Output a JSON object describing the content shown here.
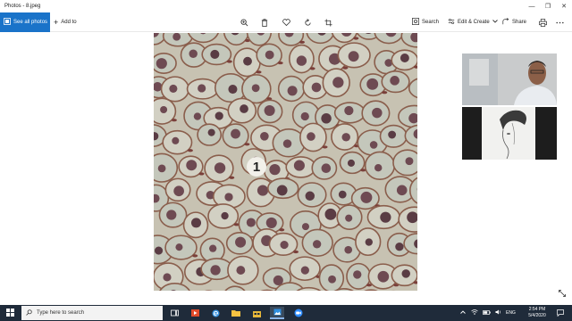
{
  "window": {
    "title": "Photos - 8.jpeg",
    "minimize_glyph": "—",
    "maximize_glyph": "❐",
    "close_glyph": "✕"
  },
  "toolbar": {
    "see_all_label": "See all photos",
    "add_to_label": "Add to",
    "add_glyph": "+",
    "search_label": "Search",
    "edit_create_label": "Edit & Create",
    "share_label": "Share",
    "icons": [
      "zoom-icon",
      "delete-icon",
      "favorite-icon",
      "rotate-icon",
      "crop-icon",
      "print-icon",
      "more-icon"
    ]
  },
  "image": {
    "region_label": "1"
  },
  "taskbar": {
    "search_placeholder": "Type here to search",
    "language": "ENG",
    "time": "2:54 PM",
    "date": "5/4/2020",
    "colors": {
      "taskbar_bg": "#1f2b3a",
      "accent": "#1a73c9"
    }
  }
}
